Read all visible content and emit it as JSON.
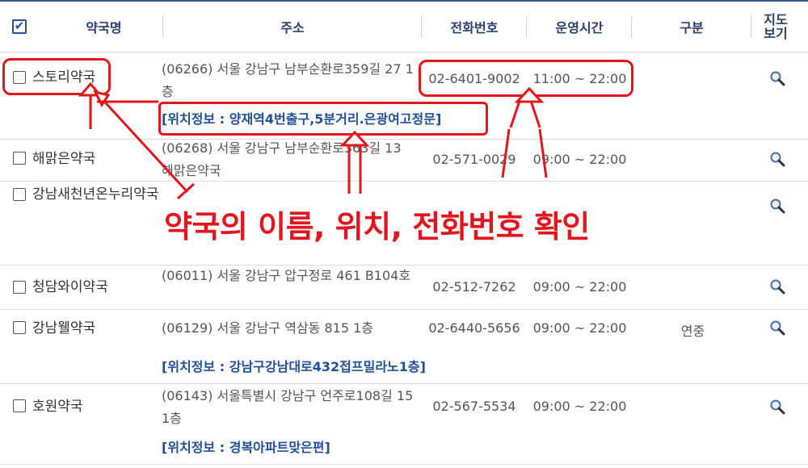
{
  "header": {
    "check_all": "✔",
    "col_name": "약국명",
    "col_address": "주소",
    "col_phone": "전화번호",
    "col_hours": "운영시간",
    "col_type": "구분",
    "col_map_line1": "지도",
    "col_map_line2": "보기"
  },
  "rows": [
    {
      "name": "스토리약국",
      "address": "(06266) 서울 강남구 남부순환로359길 27 1층",
      "location": "[위치정보 : 양재역4번출구,5분거리.은광여고정문]",
      "phone": "02-6401-9002",
      "hours": "11:00 ~ 22:00",
      "type": ""
    },
    {
      "name": "해맑은약국",
      "address": "(06268) 서울 강남구 남부순환로363길 13 해맑은약국",
      "location": "",
      "phone": "02-571-0029",
      "hours": "09:00 ~ 22:00",
      "type": ""
    },
    {
      "name": "강남새천년온누리약국",
      "address": "",
      "location": "",
      "phone": "",
      "hours": "",
      "type": ""
    },
    {
      "name": "청담와이약국",
      "address": "(06011) 서울 강남구 압구정로 461 B104호",
      "location": "",
      "phone": "02-512-7262",
      "hours": "09:00 ~ 22:00",
      "type": ""
    },
    {
      "name": "강남웰약국",
      "address": "(06129) 서울 강남구 역삼동 815 1층",
      "location": "[위치정보 : 강남구강남대로432접프밀라노1층]",
      "phone": "02-6440-5656",
      "hours": "09:00 ~ 22:00",
      "type": "연중"
    },
    {
      "name": "호원약국",
      "address": "(06143) 서울특별시 강남구 언주로108길 15 1층",
      "location": "[위치정보 : 경복아파트맞은편]",
      "phone": "02-567-5534",
      "hours": "09:00 ~ 22:00",
      "type": ""
    }
  ],
  "annotation": {
    "caption": "약국의 이름, 위치, 전화번호 확인",
    "color": "#e3161e"
  },
  "colors": {
    "header_text": "#2a3f6b",
    "location_text": "#1f4f9a"
  }
}
